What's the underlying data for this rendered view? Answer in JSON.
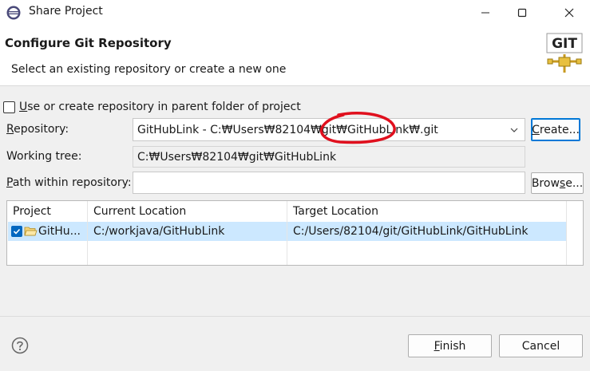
{
  "window": {
    "title": "Share Project",
    "controls": [
      "minimize-icon",
      "maximize-icon",
      "close-icon"
    ]
  },
  "header": {
    "title": "Configure Git Repository",
    "description": "Select an existing repository or create a new one",
    "logo_text": "GIT"
  },
  "parent_option": {
    "checked": false,
    "label_first": "U",
    "label_rest": "se or create repository in parent folder of project"
  },
  "repository": {
    "label_first": "R",
    "label_rest": "epository:",
    "value": "GitHubLink - C:₩Users₩82104₩git₩GitHubLink₩.git",
    "create_first": "C",
    "create_rest": "reate..."
  },
  "working_tree": {
    "label": "Working tree:",
    "value": "C:₩Users₩82104₩git₩GitHubLink"
  },
  "path_within": {
    "label_first": "P",
    "label_rest": "ath within repository:",
    "value": "",
    "browse_pre": "Brow",
    "browse_ul": "s",
    "browse_post": "e..."
  },
  "table": {
    "headers": [
      "Project",
      "Current Location",
      "Target Location"
    ],
    "rows": [
      {
        "checked": true,
        "project": "GitHu...",
        "current": "C:/workjava/GitHubLink",
        "target": "C:/Users/82104/git/GitHubLink/GitHubLink"
      }
    ]
  },
  "footer": {
    "finish_first": "F",
    "finish_rest": "inish",
    "cancel": "Cancel"
  },
  "colors": {
    "selection": "#cce8ff",
    "checkbox_blue": "#0067c0",
    "annotation_red": "#e0101e"
  }
}
